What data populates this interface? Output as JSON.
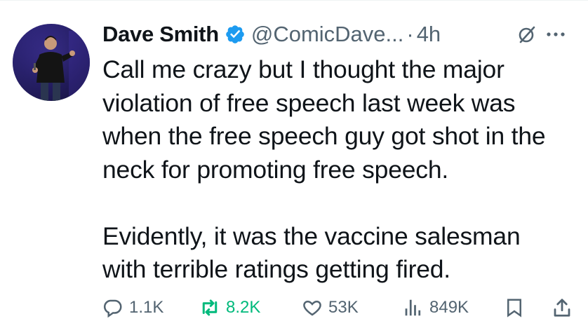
{
  "post": {
    "author_name": "Dave Smith",
    "handle": "@ComicDave...",
    "separator": "·",
    "time": "4h",
    "text": "Call me crazy but I thought the major\nviolation of free speech last week was\nwhen the free speech guy got shot in the\nneck for promoting free speech.\n\nEvidently, it was the vaccine salesman\nwith terrible ratings getting fired."
  },
  "actions": {
    "replies": "1.1K",
    "reposts": "8.2K",
    "likes": "53K",
    "views": "849K"
  },
  "colors": {
    "verified": "#1d9bf0",
    "repost_active": "#00ba7c",
    "muted": "#536471"
  }
}
